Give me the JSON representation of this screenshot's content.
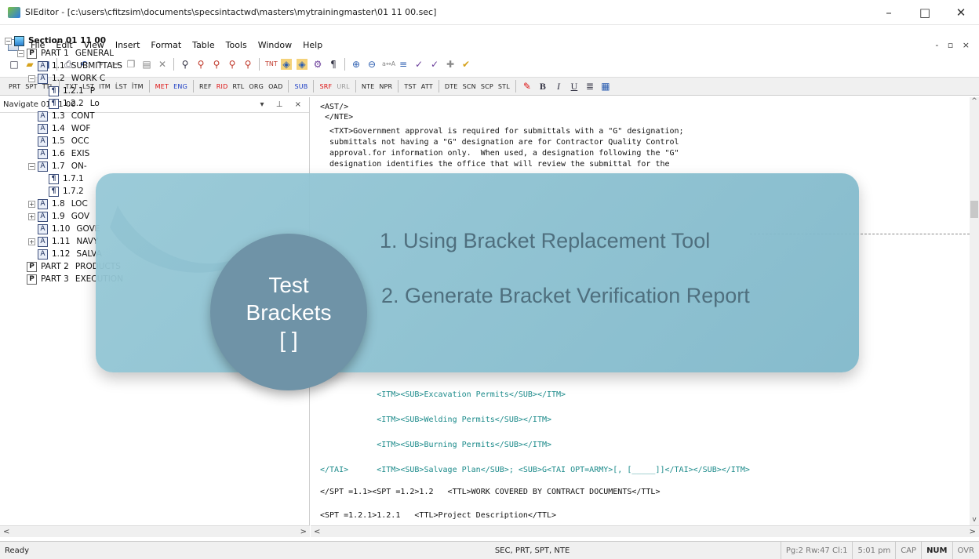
{
  "window": {
    "title": "SIEditor - [c:\\users\\cfitzsim\\documents\\specsintactwd\\masters\\mytrainingmaster\\01 11 00.sec]",
    "controls": [
      "–",
      "□",
      "✕"
    ]
  },
  "menu": {
    "items": [
      "File",
      "Edit",
      "View",
      "Insert",
      "Format",
      "Table",
      "Tools",
      "Window",
      "Help"
    ],
    "mdi_controls": "- ▫ ×"
  },
  "toolbar1": {
    "icons": [
      "new-icon",
      "open-icon",
      "save-icon",
      "print-icon",
      "undo-icon",
      "redo-icon",
      "cut-icon",
      "copy-icon",
      "paste-icon",
      "delete-icon",
      "find-icon",
      "find-next-icon",
      "binoculars-icon",
      "binoculars-2-icon",
      "binoculars-3-icon",
      "tag-icon",
      "view-tags-icon",
      "view-tags-2-icon",
      "txt-icon",
      "pilcrow-icon",
      "zoom-in-icon",
      "zoom-out-icon",
      "sort-icon",
      "align-icon",
      "spell-icon",
      "spell-2-icon",
      "add-icon",
      "check-icon"
    ]
  },
  "toolbar2": {
    "tags": [
      {
        "label": "PRT",
        "color": ""
      },
      {
        "label": "SPT",
        "color": ""
      },
      {
        "label": "TTL",
        "color": ""
      },
      {
        "label": "TXT",
        "color": ""
      },
      {
        "label": "LST",
        "color": ""
      },
      {
        "label": "ITM",
        "color": ""
      },
      {
        "label": "ĹST",
        "color": ""
      },
      {
        "label": "ǏTM",
        "color": ""
      },
      {
        "label": "MET",
        "color": "red"
      },
      {
        "label": "ENG",
        "color": "blue"
      },
      {
        "label": "REF",
        "color": ""
      },
      {
        "label": "RID",
        "color": "red"
      },
      {
        "label": "RTL",
        "color": ""
      },
      {
        "label": "ORG",
        "color": ""
      },
      {
        "label": "OAD",
        "color": ""
      },
      {
        "label": "SUB",
        "color": "blue"
      },
      {
        "label": "SRF",
        "color": "red"
      },
      {
        "label": "URL",
        "color": ""
      },
      {
        "label": "NTE",
        "color": ""
      },
      {
        "label": "NPR",
        "color": ""
      },
      {
        "label": "TST",
        "color": ""
      },
      {
        "label": "ATT",
        "color": ""
      },
      {
        "label": "DTE",
        "color": ""
      },
      {
        "label": "SCN",
        "color": ""
      },
      {
        "label": "SCP",
        "color": ""
      },
      {
        "label": "STL",
        "color": ""
      }
    ],
    "format_buttons": [
      "B",
      "I",
      "U"
    ]
  },
  "nav": {
    "title": "Navigate 01 11 00",
    "controls": "▾ ⊥ ×",
    "section": "Section 01 11 00",
    "nodes": [
      {
        "num": "PART 1",
        "label": "GENERAL",
        "icon": "P"
      },
      {
        "num": "1.1",
        "label": "SUBMITTALS",
        "icon": "A"
      },
      {
        "num": "1.2",
        "label": "WORK C",
        "icon": "A"
      },
      {
        "num": "1.2.1",
        "label": "P",
        "icon": "¶"
      },
      {
        "num": "1.2.2",
        "label": "Lo",
        "icon": "¶"
      },
      {
        "num": "1.3",
        "label": "CONT",
        "icon": "A"
      },
      {
        "num": "1.4",
        "label": "WOF",
        "icon": "A"
      },
      {
        "num": "1.5",
        "label": "OCC",
        "icon": "A"
      },
      {
        "num": "1.6",
        "label": "EXIS",
        "icon": "A"
      },
      {
        "num": "1.7",
        "label": "ON-",
        "icon": "A"
      },
      {
        "num": "1.7.1",
        "label": "",
        "icon": "¶"
      },
      {
        "num": "1.7.2",
        "label": "",
        "icon": "¶"
      },
      {
        "num": "1.8",
        "label": "LOC",
        "icon": "A"
      },
      {
        "num": "1.9",
        "label": "GOV",
        "icon": "A"
      },
      {
        "num": "1.10",
        "label": "GOVE",
        "icon": "A"
      },
      {
        "num": "1.11",
        "label": "NAVY",
        "icon": "A"
      },
      {
        "num": "1.12",
        "label": "SALVA",
        "icon": "A"
      },
      {
        "num": "PART 2",
        "label": "PRODUCTS",
        "icon": "P"
      },
      {
        "num": "PART 3",
        "label": "EXECUTION",
        "icon": "P"
      }
    ]
  },
  "editor": {
    "lines": [
      "<AST/>",
      " </NTE>",
      "  <TXT>Government approval is required for submittals with a \"G\" designation;",
      "  submittals not having a \"G\" designation are for Contractor Quality Control",
      "  approval.for information only.  When used, a designation following the \"G\"",
      "  designation identifies the office that will review the submittal for the",
      "            <ITM><SUB>Excavation Permits</SUB></ITM>",
      "            <ITM><SUB>Welding Permits</SUB></ITM>",
      "            <ITM><SUB>Burning Permits</SUB></ITM>",
      "</TAI>      <ITM><SUB>Salvage Plan</SUB>; <SUB>G<TAI OPT=ARMY>[, [_____]]</TAI></SUB></ITM>",
      "</SPT =1.1><SPT =1.2>1.2   <TTL>WORK COVERED BY CONTRACT DOCUMENTS</TTL>",
      "<SPT =1.2.1>1.2.1   <TTL>Project Description</TTL>"
    ]
  },
  "overlay": {
    "item1": "1. Using Bracket Replacement Tool",
    "item2": "2.  Generate Bracket Verification Report",
    "circle_line1": "Test",
    "circle_line2": "Brackets",
    "circle_line3": "[ ]"
  },
  "status": {
    "ready": "Ready",
    "context": "SEC, PRT, SPT, NTE",
    "position": "Pg:2 Rw:47 Cl:1",
    "time": "5:01 pm",
    "cap": "CAP",
    "num": "NUM",
    "ovr": "OVR"
  }
}
